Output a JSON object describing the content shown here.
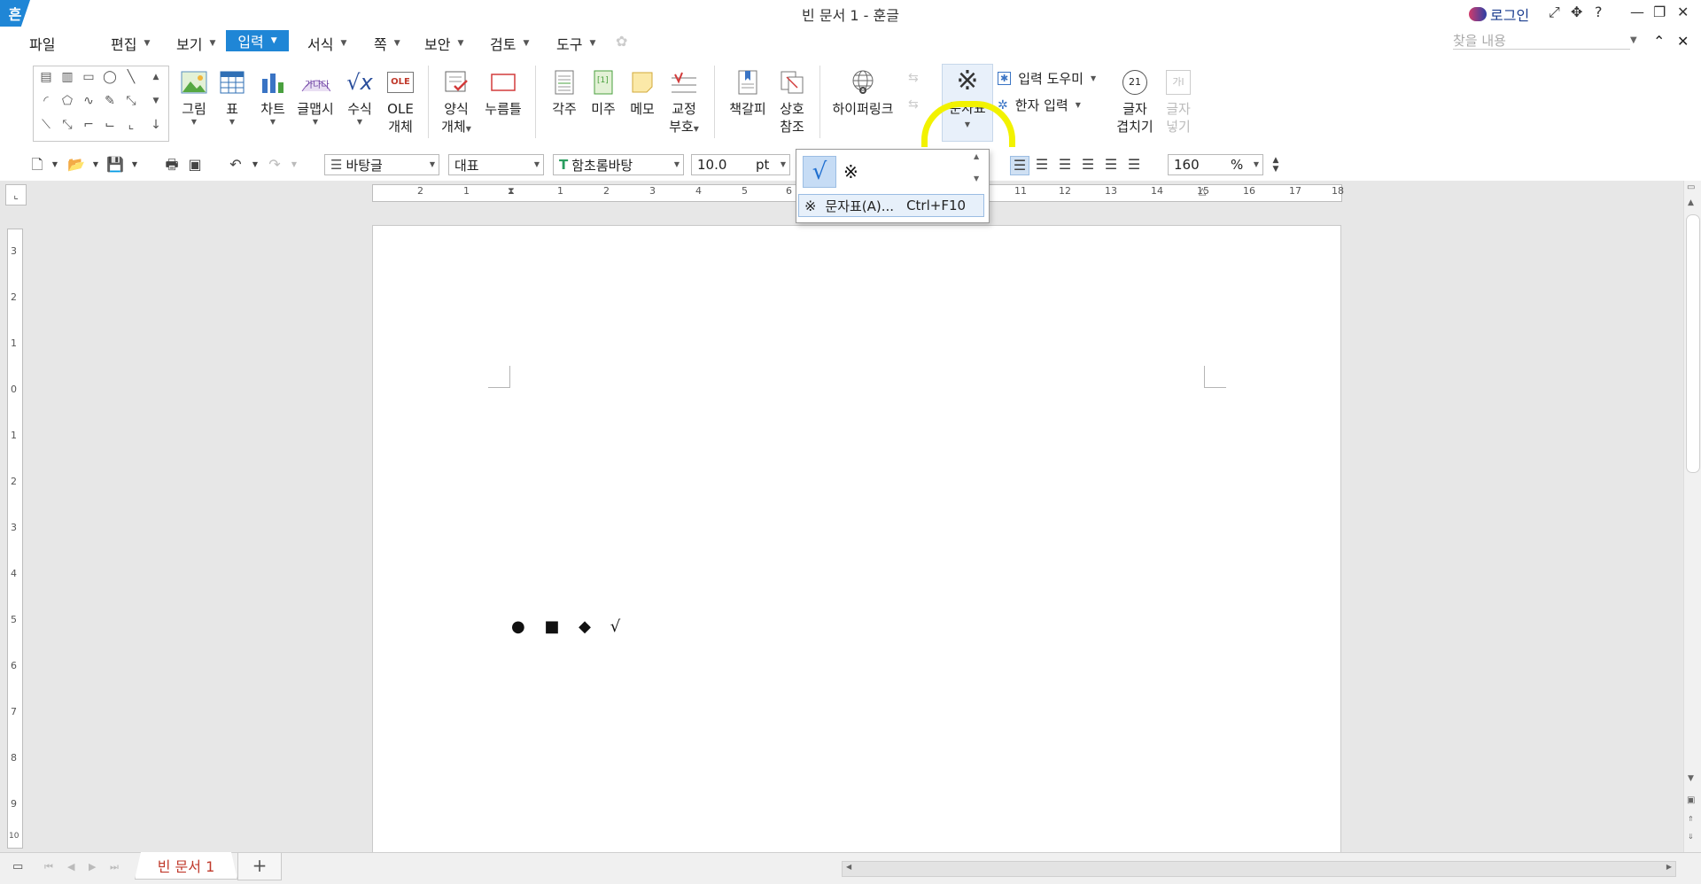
{
  "titlebar": {
    "app_logo": "흔",
    "title": "빈 문서 1 - 훈글",
    "login": "로그인",
    "help": "?"
  },
  "menu": {
    "file": "파일",
    "edit": "편집",
    "view": "보기",
    "input": "입력",
    "format": "서식",
    "page": "쪽",
    "security": "보안",
    "review": "검토",
    "tools": "도구",
    "find_placeholder": "찾을 내용"
  },
  "ribbon": {
    "picture": "그림",
    "table": "표",
    "chart": "차트",
    "wordart": "글맵시",
    "formula": "수식",
    "ole_line1": "OLE",
    "ole_line2": "개체",
    "ole_icon_text": "OLE",
    "form_line1": "양식",
    "form_line2": "개체",
    "press_frame": "누름틀",
    "footnote": "각주",
    "endnote": "미주",
    "memo": "메모",
    "proof_line1": "교정",
    "proof_line2": "부호",
    "bookmark": "책갈피",
    "crossref_line1": "상호",
    "crossref_line2": "참조",
    "hyperlink": "하이퍼링크",
    "charmap": "문자표",
    "input_helper": "입력 도우미",
    "hanja_input": "한자 입력",
    "overlap_line1": "글자",
    "overlap_line2": "겹치기",
    "overlap_icon_text": "21",
    "insert_line1": "글자",
    "insert_line2": "넣기",
    "insert_icon_text": "가I"
  },
  "toolbar": {
    "style": "바탕글",
    "lang": "대표",
    "font": "함초롬바탕",
    "size": "10.0",
    "size_unit": "pt",
    "zoom": "160",
    "zoom_unit": "%"
  },
  "ruler": {
    "h_ticks": [
      "2",
      "1",
      "1",
      "2",
      "3",
      "4",
      "5",
      "6",
      "11",
      "12",
      "13",
      "14",
      "15",
      "16",
      "17",
      "18"
    ],
    "v_ticks": [
      "3",
      "2",
      "1",
      "0",
      "1",
      "2",
      "3",
      "4",
      "5",
      "6",
      "7",
      "8",
      "9",
      "10"
    ]
  },
  "document": {
    "symbols": "● ■ ◆ √"
  },
  "popup": {
    "recent_1": "√",
    "recent_2": "※",
    "item_icon": "※",
    "item_label": "문자표(A)...",
    "item_shortcut": "Ctrl+F10"
  },
  "status": {
    "doc_tab": "빈 문서 1",
    "add_tab": "+"
  },
  "colors": {
    "accent": "#1f86d6",
    "highlight": "#f2f200",
    "tab_text": "#c0392b"
  }
}
